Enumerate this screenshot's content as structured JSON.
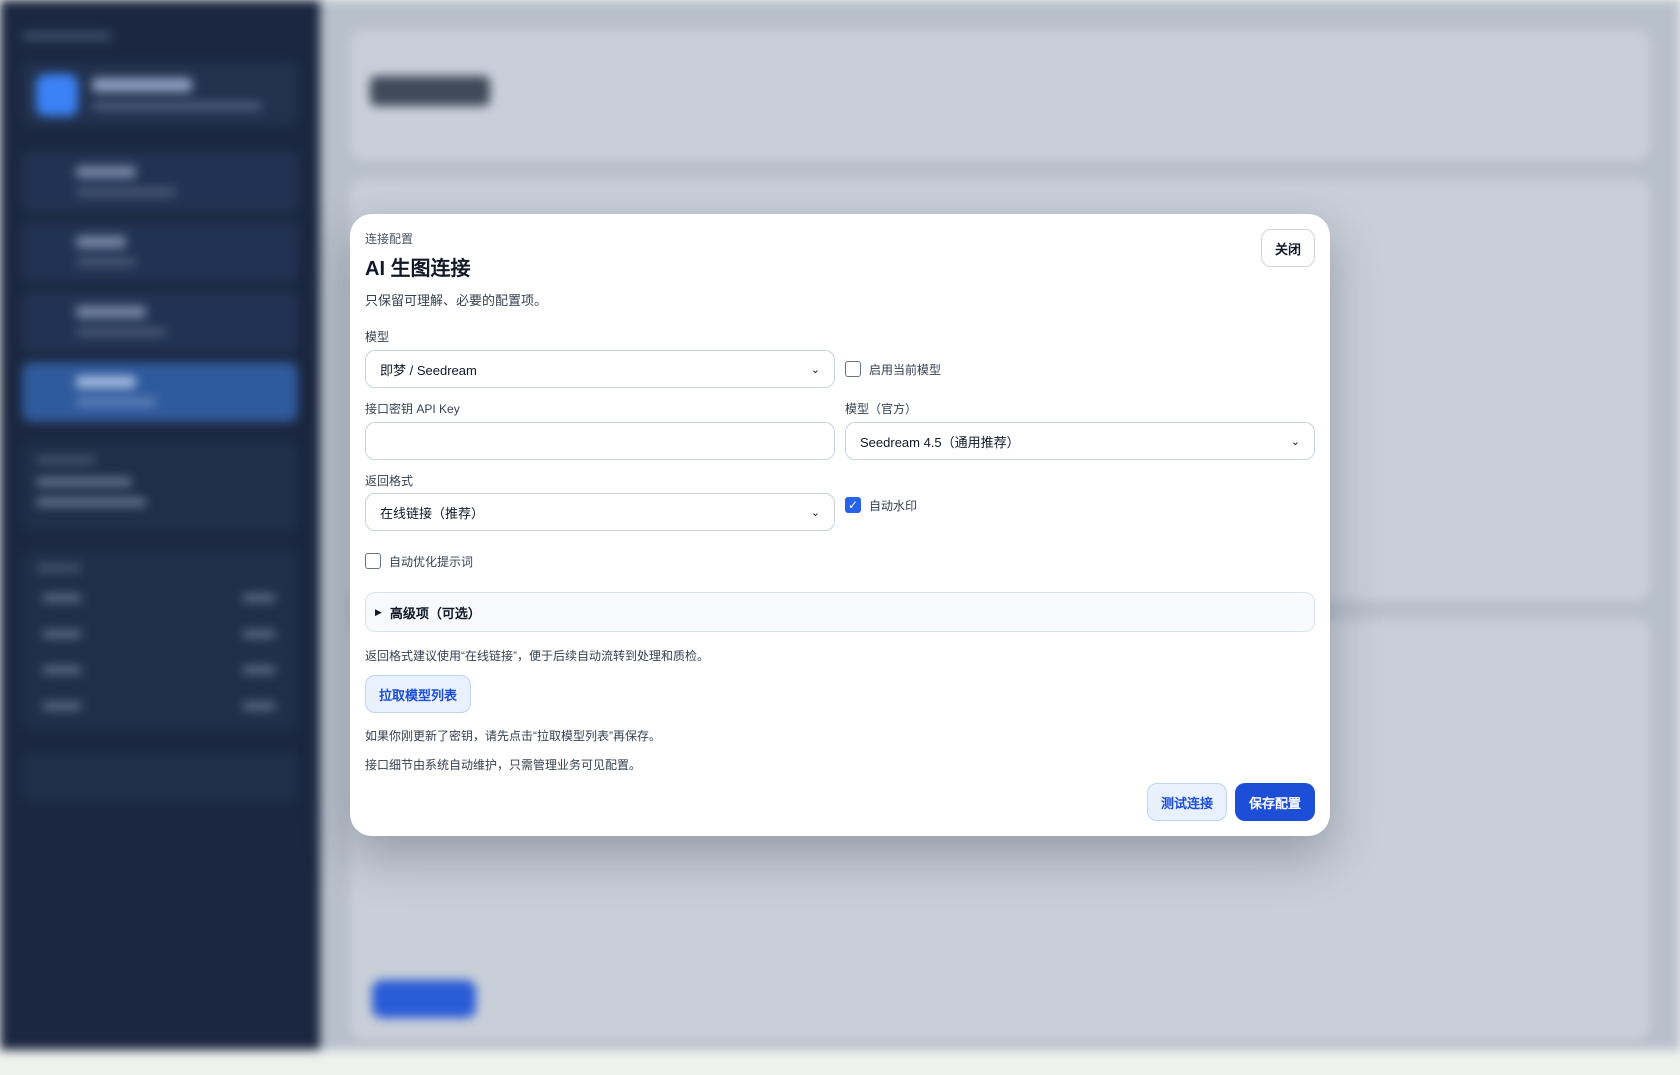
{
  "modal": {
    "eyebrow": "连接配置",
    "title": "AI 生图连接",
    "subtitle": "只保留可理解、必要的配置项。",
    "close_label": "关闭",
    "model": {
      "label": "模型",
      "value": "即梦 / Seedream"
    },
    "enable_current": {
      "label": "启用当前模型",
      "checked": false
    },
    "api_key": {
      "label": "接口密钥 API Key",
      "value": ""
    },
    "official_model": {
      "label": "模型（官方）",
      "value": "Seedream 4.5（通用推荐）"
    },
    "return_format": {
      "label": "返回格式",
      "value": "在线链接（推荐）"
    },
    "auto_watermark": {
      "label": "自动水印",
      "checked": true
    },
    "auto_optimize": {
      "label": "自动优化提示词",
      "checked": false
    },
    "advanced_label": "高级项（可选）",
    "hint_format": "返回格式建议使用“在线链接”，便于后续自动流转到处理和质检。",
    "fetch_label": "拉取模型列表",
    "hint_key": "如果你刚更新了密钥，请先点击“拉取模型列表”再保存。",
    "hint_system": "接口细节由系统自动维护，只需管理业务可见配置。",
    "test_label": "测试连接",
    "save_label": "保存配置"
  },
  "icons": {
    "chevron": "chevron-down-icon",
    "check": "check-icon",
    "disclosure": "disclosure-triangle-icon"
  },
  "colors": {
    "primary": "#1d4ed8",
    "primary_light": "#e8f1fd",
    "sidebar_bg": "#1b2740"
  }
}
